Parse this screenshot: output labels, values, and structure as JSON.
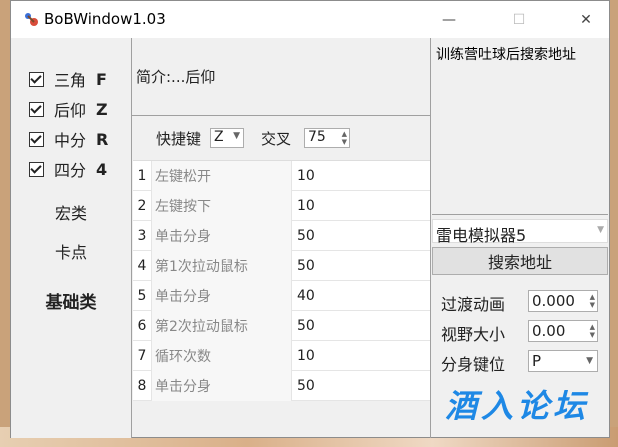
{
  "window": {
    "title": "BoBWindow1.03"
  },
  "window_controls": {
    "minimize": "—",
    "maximize": "☐",
    "close": "✕"
  },
  "checkboxes": [
    {
      "label": "三角",
      "key": "F",
      "checked": true
    },
    {
      "label": "后仰",
      "key": "Z",
      "checked": true
    },
    {
      "label": "中分",
      "key": "R",
      "checked": true
    },
    {
      "label": "四分",
      "key": "4",
      "checked": true
    }
  ],
  "nav": [
    {
      "label": "宏类"
    },
    {
      "label": "卡点"
    },
    {
      "label": "基础类"
    }
  ],
  "intro": "简介:...后仰",
  "hotkey": {
    "label": "快捷键",
    "value": "Z"
  },
  "cross": {
    "label": "交叉",
    "value": "75"
  },
  "steps": [
    {
      "idx": "1",
      "name": "左键松开",
      "value": "10"
    },
    {
      "idx": "2",
      "name": "左键按下",
      "value": "10"
    },
    {
      "idx": "3",
      "name": "单击分身",
      "value": "50"
    },
    {
      "idx": "4",
      "name": "第1次拉动鼠标",
      "value": "50"
    },
    {
      "idx": "5",
      "name": "单击分身",
      "value": "40"
    },
    {
      "idx": "6",
      "name": "第2次拉动鼠标",
      "value": "50"
    },
    {
      "idx": "7",
      "name": "循环次数",
      "value": "10"
    },
    {
      "idx": "8",
      "name": "单击分身",
      "value": "50"
    }
  ],
  "right": {
    "box_title": "训练营吐球后搜索地址",
    "emulator": "雷电模拟器5",
    "search_button": "搜索地址",
    "params": [
      {
        "label": "过渡动画",
        "value": "0.000"
      },
      {
        "label": "视野大小",
        "value": "0.00"
      },
      {
        "label": "分身键位",
        "value": "P"
      }
    ]
  },
  "watermark": "酒入论坛",
  "colors": {
    "watermark": "#1e88e5",
    "window_bg": "#f0f0f0"
  }
}
